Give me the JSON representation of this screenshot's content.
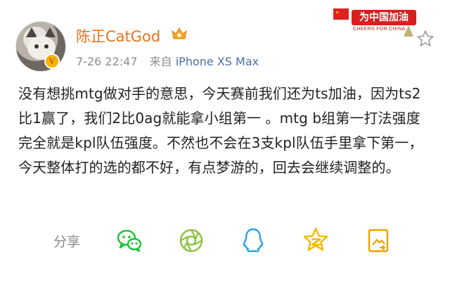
{
  "post": {
    "author": "陈正CatGod",
    "time": "7-26 22:47",
    "source_prefix": "来自",
    "device": "iPhone XS Max",
    "content": "没有想挑mtg做对手的意思，今天赛前我们还为ts加油，因为ts2比1赢了，我们2比0ag就能拿小组第一 。mtg b组第一打法强度完全就是kpl队伍强度。不然也不会在3支kpl队伍手里拿下第一，今天整体打的选的都不好，有点梦游的，回去会继续调整的。"
  },
  "campaign": {
    "title": "为中国加油",
    "subtitle": "CHEERS FOR CHINA"
  },
  "share": {
    "label": "分享",
    "targets": [
      {
        "name": "WeChat",
        "icon": "wechat-icon",
        "color": "#19c337"
      },
      {
        "name": "Moments",
        "icon": "moments-icon",
        "color": "#8ac53e"
      },
      {
        "name": "QQ",
        "icon": "qq-icon",
        "color": "#2aa2e6"
      },
      {
        "name": "Qzone",
        "icon": "qzone-icon",
        "color": "#f5b800"
      },
      {
        "name": "Save image",
        "icon": "save-image-icon",
        "color": "#f0a000"
      }
    ]
  },
  "colors": {
    "username": "#e8731a",
    "meta": "#8e8e8e",
    "device_link": "#4a6fa5",
    "verify_badge": "#f6b400"
  }
}
